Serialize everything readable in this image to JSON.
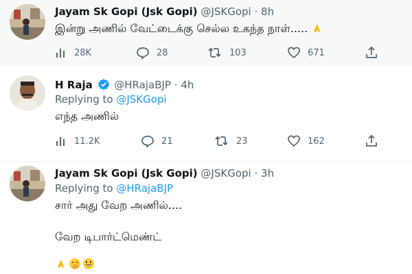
{
  "tweets": [
    {
      "name": "Jayam Sk Gopi (Jsk Gopi)",
      "handle": "@JSKGopi",
      "dot": "·",
      "time": "8h",
      "text": "இன்று அணில் வேட்டைக்கு செல்ல உகந்த நாள்.....",
      "emoji": "folded-hands",
      "stats": {
        "views": "28K",
        "replies": "28",
        "retweets": "103",
        "likes": "671"
      }
    },
    {
      "name": "H Raja",
      "handle": "@HRajaBJP",
      "dot": "·",
      "time": "4h",
      "verified": true,
      "replying_label": "Replying to",
      "replying_handle": "@JSKGopi",
      "text": "எந்த அணில்",
      "stats": {
        "views": "11.2K",
        "replies": "21",
        "retweets": "23",
        "likes": "162"
      }
    },
    {
      "name": "Jayam Sk Gopi (Jsk Gopi)",
      "handle": "@JSKGopi",
      "dot": "·",
      "time": "3h",
      "replying_label": "Replying to",
      "replying_handle": "@HRajaBJP",
      "text_line1": "சார் அது வேற அணில்....",
      "text_line2": "வேற டிபார்ட்மெண்ட்",
      "emojis": [
        "folded-hands",
        "face-with-hand-over-mouth",
        "grinning-face"
      ]
    }
  ],
  "colors": {
    "accent": "#1d9bf0",
    "muted": "#536471",
    "text": "#0f1419",
    "highlight_bg": "#f7f9f9"
  }
}
